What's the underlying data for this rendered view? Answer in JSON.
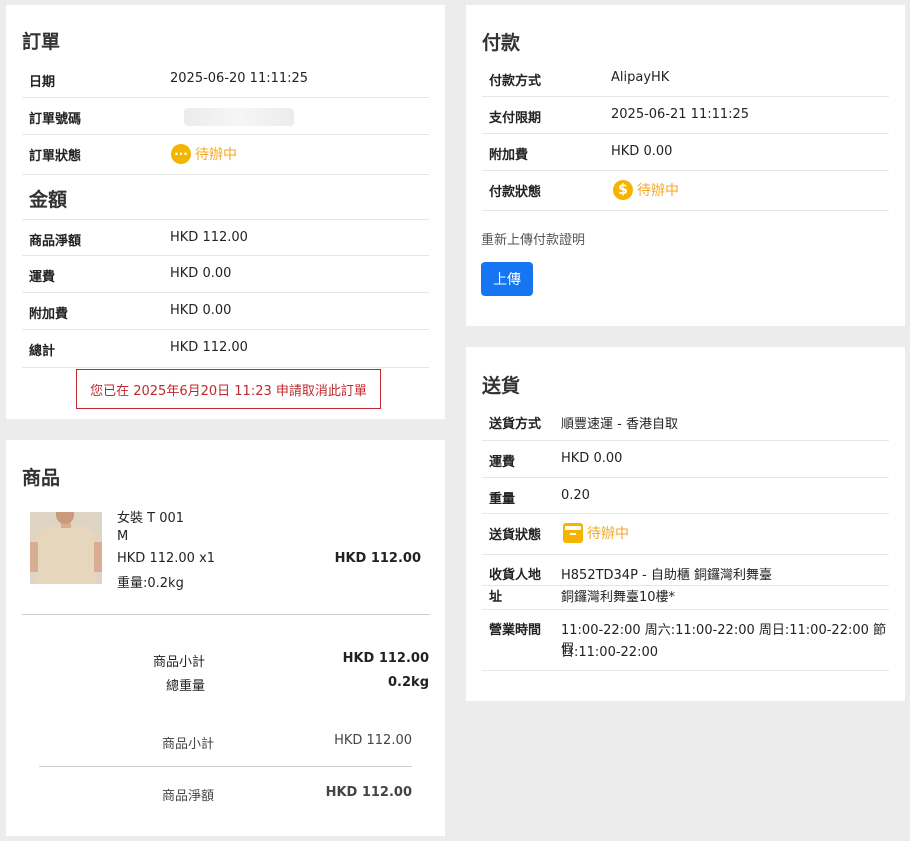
{
  "order": {
    "title": "訂單",
    "rows": [
      {
        "label": "日期",
        "value": "2025-06-20 11:11:25"
      },
      {
        "label": "訂單號碼",
        "value": ""
      },
      {
        "label": "訂單狀態",
        "status": "待辦中",
        "icon": "more-horizontal-icon"
      }
    ],
    "amount_title": "金額",
    "amount_rows": [
      {
        "label": "商品淨額",
        "value": "HKD 112.00"
      },
      {
        "label": "運費",
        "value": "HKD 0.00"
      },
      {
        "label": "附加費",
        "value": "HKD 0.00"
      },
      {
        "label": "總計",
        "value": "HKD 112.00"
      }
    ],
    "cancel_notice": "您已在 2025年6月20日 11:23 申請取消此訂單"
  },
  "products": {
    "title": "商品",
    "item": {
      "name": "女裝 T 001",
      "variant": "M",
      "price_qty": "HKD 112.00 x1",
      "weight": "重量:0.2kg",
      "line_total": "HKD 112.00",
      "image_icon": "product-photo-tshirt"
    },
    "summary": [
      {
        "label": "商品小計",
        "value": "HKD 112.00"
      },
      {
        "label": "總重量",
        "value": "0.2kg"
      }
    ],
    "totals": [
      {
        "label": "商品小計",
        "value": "HKD 112.00"
      },
      {
        "label": "商品淨額",
        "value": "HKD 112.00"
      }
    ]
  },
  "payment": {
    "title": "付款",
    "rows": [
      {
        "label": "付款方式",
        "value": "AlipayHK"
      },
      {
        "label": "支付限期",
        "value": "2025-06-21 11:11:25"
      },
      {
        "label": "附加費",
        "value": "HKD 0.00"
      },
      {
        "label": "付款狀態",
        "status": "待辦中",
        "icon": "dollar-icon"
      }
    ],
    "reupload_label": "重新上傳付款證明",
    "upload_button": "上傳"
  },
  "delivery": {
    "title": "送貨",
    "rows": [
      {
        "label": "送貨方式",
        "value": "順豐速運 - 香港自取"
      },
      {
        "label": "運費",
        "value": "HKD 0.00"
      },
      {
        "label": "重量",
        "value": "0.20"
      },
      {
        "label": "送貨狀態",
        "status": "待辦中",
        "icon": "archive-box-icon"
      },
      {
        "label_line1": "收貨人地",
        "label_line2": "址",
        "value_line1": "H852TD34P - 自助櫃 銅鑼灣利舞臺",
        "value_line2": "銅鑼灣利舞臺10樓*"
      },
      {
        "label": "營業時間",
        "value_line1": "11:00-22:00 周六:11:00-22:00 周日:11:00-22:00 節假",
        "value_line2": "日:11:00-22:00"
      }
    ]
  },
  "colors": {
    "status": "#f5a623",
    "primary_button": "#1675f2",
    "notice": "#c0282d"
  }
}
